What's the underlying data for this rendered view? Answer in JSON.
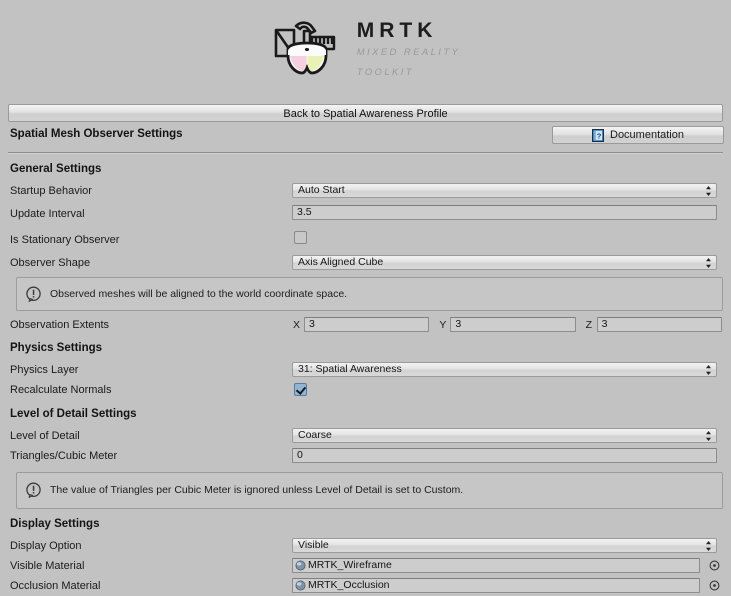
{
  "logo": {
    "icon_name": "mrtk-logo-icon",
    "title": "MRTK",
    "subtitle_line1": "MIXED REALITY",
    "subtitle_line2": "TOOLKIT"
  },
  "toolbar": {
    "back_button_label": "Back to Spatial Awareness Profile",
    "page_title": "Spatial Mesh Observer Settings",
    "documentation_label": "Documentation",
    "documentation_icon": "help-book-icon"
  },
  "sections": {
    "general": {
      "heading": "General Settings",
      "startup_behavior": {
        "label": "Startup Behavior",
        "value": "Auto Start"
      },
      "update_interval": {
        "label": "Update Interval",
        "value": "3.5"
      },
      "is_stationary_observer": {
        "label": "Is Stationary Observer",
        "checked": false
      },
      "observer_shape": {
        "label": "Observer Shape",
        "value": "Axis Aligned Cube"
      },
      "info": "Observed meshes will be aligned to the world coordinate space.",
      "observation_extents": {
        "label": "Observation Extents",
        "axes": [
          {
            "axis": "X",
            "value": "3"
          },
          {
            "axis": "Y",
            "value": "3"
          },
          {
            "axis": "Z",
            "value": "3"
          }
        ]
      }
    },
    "physics": {
      "heading": "Physics Settings",
      "physics_layer": {
        "label": "Physics Layer",
        "value": "31: Spatial Awareness"
      },
      "recalculate_normals": {
        "label": "Recalculate Normals",
        "checked": true
      }
    },
    "lod": {
      "heading": "Level of Detail Settings",
      "level_of_detail": {
        "label": "Level of Detail",
        "value": "Coarse"
      },
      "triangles_per_cubic_meter": {
        "label": "Triangles/Cubic Meter",
        "value": "0"
      },
      "info": "The value of Triangles per Cubic Meter is ignored unless Level of Detail is set to Custom."
    },
    "display": {
      "heading": "Display Settings",
      "display_option": {
        "label": "Display Option",
        "value": "Visible"
      },
      "visible_material": {
        "label": "Visible Material",
        "value": "MRTK_Wireframe",
        "icon": "material-sphere-icon"
      },
      "occlusion_material": {
        "label": "Occlusion Material",
        "value": "MRTK_Occlusion",
        "icon": "material-sphere-icon"
      }
    }
  },
  "icons": {
    "info": "info-bubble-icon",
    "object_picker": "object-picker-icon",
    "dropdown": "updown-arrows-icon"
  },
  "colors": {
    "background": "#c2c2c2",
    "checkbox_on": "#92b4d6",
    "text": "#1b1b1b",
    "logo_sub": "#9a9a9a"
  }
}
